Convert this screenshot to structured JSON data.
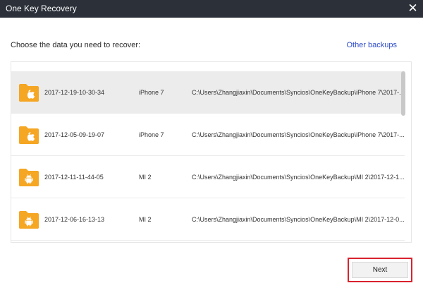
{
  "window": {
    "title": "One Key Recovery"
  },
  "prompt": "Choose the data you need to recover:",
  "other_backups": "Other backups",
  "backups": [
    {
      "date": "2017-12-19-10-30-34",
      "device": "iPhone 7",
      "path": "C:\\Users\\Zhangjiaxin\\Documents\\Syncios\\OneKeyBackup\\iPhone 7\\2017-...",
      "os": "apple",
      "selected": true
    },
    {
      "date": "2017-12-05-09-19-07",
      "device": "iPhone 7",
      "path": "C:\\Users\\Zhangjiaxin\\Documents\\Syncios\\OneKeyBackup\\iPhone 7\\2017-...",
      "os": "apple",
      "selected": false
    },
    {
      "date": "2017-12-11-11-44-05",
      "device": "MI 2",
      "path": "C:\\Users\\Zhangjiaxin\\Documents\\Syncios\\OneKeyBackup\\MI 2\\2017-12-1...",
      "os": "android",
      "selected": false
    },
    {
      "date": "2017-12-06-16-13-13",
      "device": "MI 2",
      "path": "C:\\Users\\Zhangjiaxin\\Documents\\Syncios\\OneKeyBackup\\MI 2\\2017-12-0...",
      "os": "android",
      "selected": false
    }
  ],
  "next_label": "Next",
  "colors": {
    "titlebar": "#2b3039",
    "folder": "#f5a623",
    "link": "#2e4bc9",
    "highlight": "#d9232e",
    "selected_row": "#ececec"
  }
}
